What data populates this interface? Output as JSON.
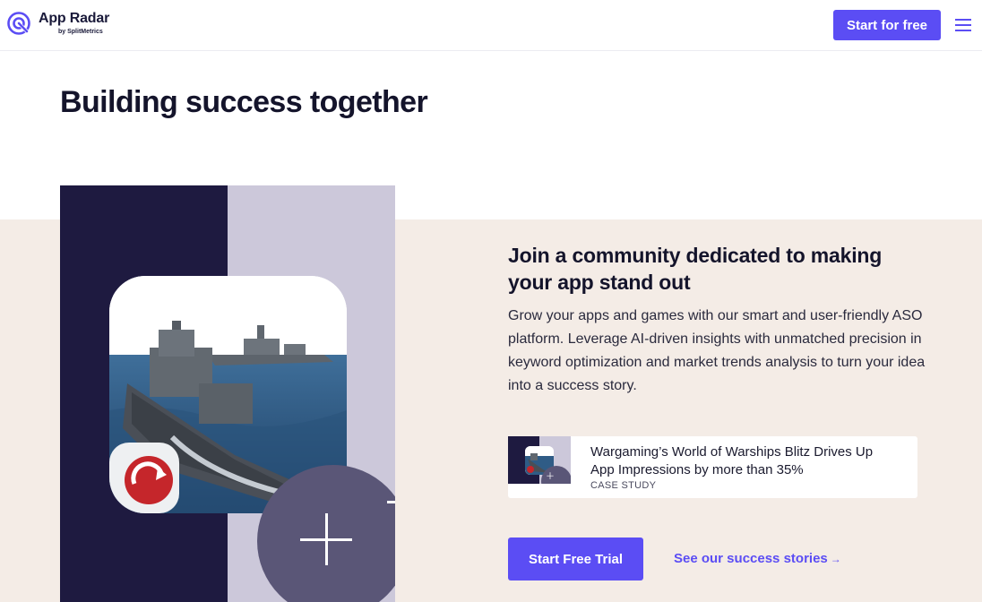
{
  "header": {
    "logo_name": "App Radar",
    "logo_by": "by SplitMetrics",
    "cta_label": "Start for free",
    "menu_icon": "hamburger-icon"
  },
  "hero": {
    "title": "Building success together"
  },
  "section": {
    "heading": "Join a community dedicated to making your app stand out",
    "description": "Grow your apps and games with our smart and user-friendly ASO platform. Leverage AI-driven insights with unmatched precision in keyword optimization and market trends analysis to turn your idea into a success story.",
    "case_study": {
      "title": "Wargaming’s World of Warships Blitz Drives Up App Impressions by more than 35%",
      "tag": "CASE STUDY"
    },
    "primary_cta": "Start Free Trial",
    "secondary_cta": "See our success stories",
    "secondary_arrow": "→"
  },
  "colors": {
    "brand": "#5b4df4",
    "dark": "#1e1a40",
    "band": "#f4ece6"
  }
}
